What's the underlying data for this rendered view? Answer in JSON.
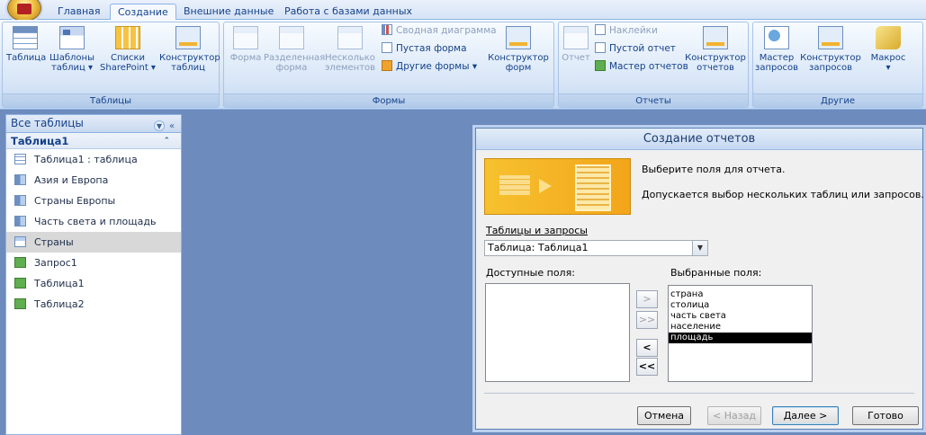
{
  "tabs": [
    "Главная",
    "Создание",
    "Внешние данные",
    "Работа с базами данных"
  ],
  "ribbon": {
    "groups": {
      "tables": {
        "label": "Таблицы",
        "buttons": [
          [
            "Таблица",
            ""
          ],
          [
            "Шаблоны",
            "таблиц ▾"
          ],
          [
            "Списки",
            "SharePoint ▾"
          ],
          [
            "Конструктор",
            "таблиц"
          ]
        ]
      },
      "forms": {
        "label": "Формы",
        "buttons": [
          [
            "Форма",
            ""
          ],
          [
            "Разделенная",
            "форма"
          ],
          [
            "Несколько",
            "элементов"
          ]
        ],
        "small": [
          "Сводная диаграмма",
          "Пустая форма",
          "Другие формы ▾"
        ],
        "constructor": [
          "Конструктор",
          "форм"
        ]
      },
      "reports": {
        "label": "Отчеты",
        "report": "Отчет",
        "small": [
          "Наклейки",
          "Пустой отчет",
          "Мастер отчетов"
        ],
        "constructor": [
          "Конструктор",
          "отчетов"
        ]
      },
      "other": {
        "label": "Другие",
        "buttons": [
          [
            "Мастер",
            "запросов"
          ],
          [
            "Конструктор",
            "запросов"
          ],
          [
            "Макрос",
            "▾"
          ]
        ]
      }
    }
  },
  "nav": {
    "title": "Все таблицы",
    "group": "Таблица1",
    "items": [
      "Таблица1 : таблица",
      "Азия и Европа",
      "Страны Европы",
      "Часть света и площадь",
      "Страны",
      "Запрос1",
      "Таблица1",
      "Таблица2"
    ]
  },
  "dialog": {
    "title": "Создание отчетов",
    "line1": "Выберите поля для отчета.",
    "line2": "Допускается выбор нескольких таблиц или запросов.",
    "tables_label": "Таблицы и запросы",
    "tables_value": "Таблица: Таблица1",
    "available_label": "Доступные поля:",
    "selected_label": "Выбранные поля:",
    "selected_fields": [
      "страна",
      "столица",
      "часть света",
      "население",
      "площадь"
    ],
    "move_buttons": [
      ">",
      ">>",
      "<",
      "<<"
    ],
    "buttons": {
      "cancel": "Отмена",
      "back": "< Назад",
      "next": "Далее >",
      "finish": "Готово"
    }
  }
}
